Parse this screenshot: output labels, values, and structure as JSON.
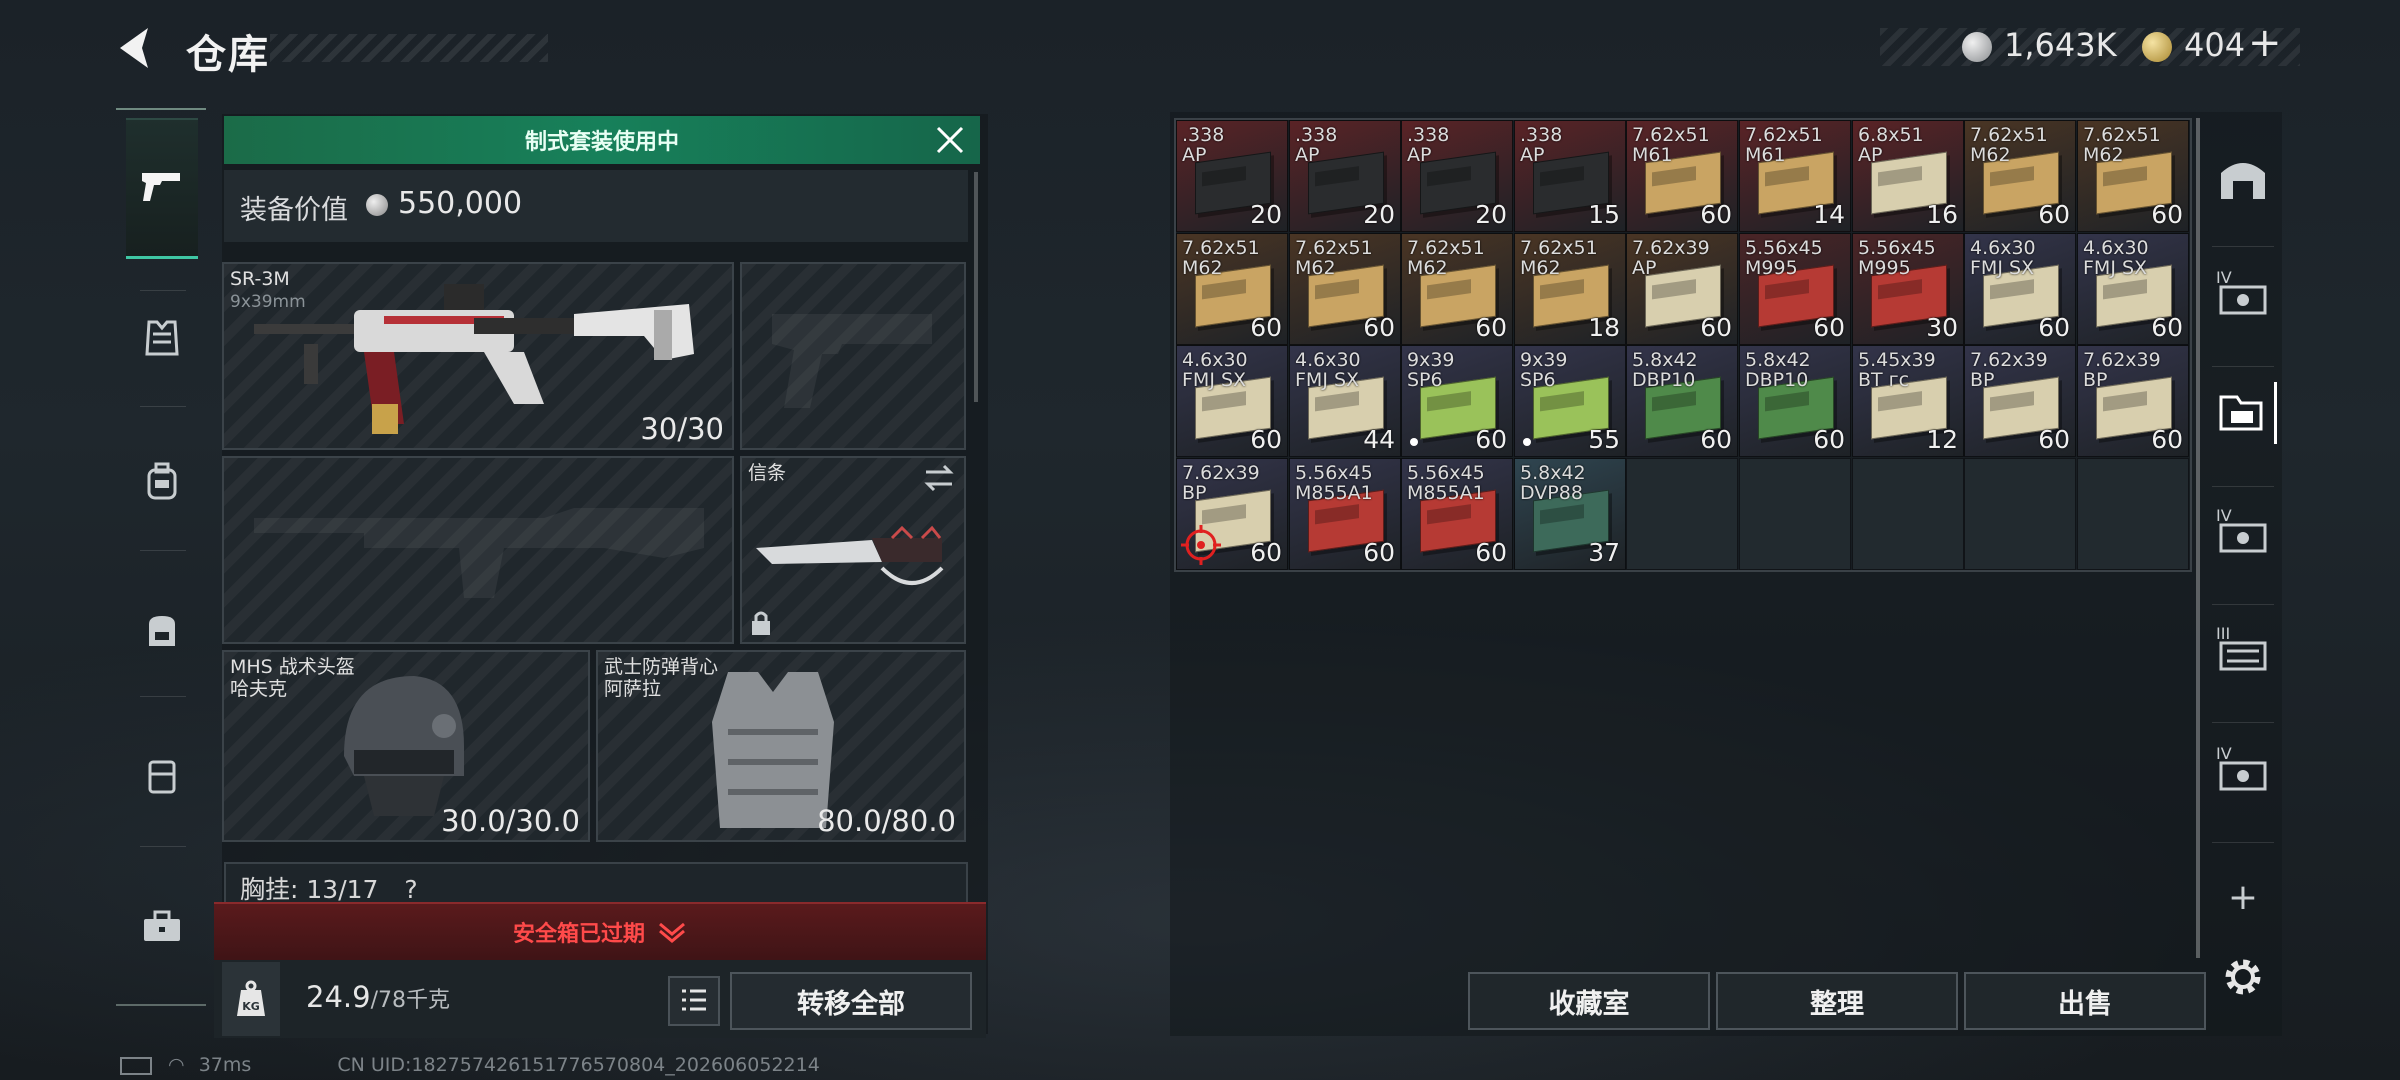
{
  "header": {
    "title": "仓库",
    "silver_amount": "1,643K",
    "gold_amount": "404",
    "add_symbol": "+"
  },
  "left_nav": {
    "icons": [
      "pistol-icon",
      "armor-vest-icon",
      "backpack-icon",
      "bag-icon",
      "case-icon",
      "toolbox-icon"
    ]
  },
  "loadout": {
    "banner": "制式套装使用中",
    "value_label": "装备价值",
    "value_amount": "550,000",
    "primary": {
      "name": "SR-3M",
      "caliber": "9x39mm",
      "ammo": "30/30"
    },
    "melee": {
      "name": "信条"
    },
    "helmet": {
      "name": "MHS 战术头盔",
      "sub": "哈夫克",
      "durability": "30.0/30.0"
    },
    "armor": {
      "name": "武士防弹背心",
      "sub": "阿萨拉",
      "durability": "80.0/80.0"
    },
    "chest_rig": {
      "label": "胸挂:",
      "capacity": "13/17",
      "help": "?"
    },
    "safe_box": "安全箱已过期",
    "weight_current": "24.9",
    "weight_max": "/78千克",
    "kg_label": "KG",
    "transfer_all": "转移全部"
  },
  "storage": {
    "cells": [
      {
        "l1": ".338",
        "l2": "AP",
        "count": "20",
        "bg": "#5a2326",
        "box": "#2a2c2e"
      },
      {
        "l1": ".338",
        "l2": "AP",
        "count": "20",
        "bg": "#5a2326",
        "box": "#2a2c2e"
      },
      {
        "l1": ".338",
        "l2": "AP",
        "count": "20",
        "bg": "#5a2326",
        "box": "#2a2c2e"
      },
      {
        "l1": ".338",
        "l2": "AP",
        "count": "15",
        "bg": "#5a2326",
        "box": "#2a2c2e"
      },
      {
        "l1": "7.62x51",
        "l2": "M61",
        "count": "60",
        "bg": "#5a2326",
        "box": "#c9a463"
      },
      {
        "l1": "7.62x51",
        "l2": "M61",
        "count": "14",
        "bg": "#5a2326",
        "box": "#c9a463"
      },
      {
        "l1": "6.8x51",
        "l2": "AP",
        "count": "16",
        "bg": "#5a2326",
        "box": "#d8cfae"
      },
      {
        "l1": "7.62x51",
        "l2": "M62",
        "count": "60",
        "bg": "#4a3524",
        "box": "#c9a463"
      },
      {
        "l1": "7.62x51",
        "l2": "M62",
        "count": "60",
        "bg": "#4a3524",
        "box": "#c9a463"
      },
      {
        "l1": "7.62x51",
        "l2": "M62",
        "count": "60",
        "bg": "#4a3524",
        "box": "#c9a463"
      },
      {
        "l1": "7.62x51",
        "l2": "M62",
        "count": "60",
        "bg": "#4a3524",
        "box": "#c9a463"
      },
      {
        "l1": "7.62x51",
        "l2": "M62",
        "count": "60",
        "bg": "#4a3524",
        "box": "#c9a463"
      },
      {
        "l1": "7.62x51",
        "l2": "M62",
        "count": "18",
        "bg": "#4a3524",
        "box": "#c9a463"
      },
      {
        "l1": "7.62x39",
        "l2": "AP",
        "count": "60",
        "bg": "#4a3524",
        "box": "#d8cfae"
      },
      {
        "l1": "5.56x45",
        "l2": "M995",
        "count": "60",
        "bg": "#4a2426",
        "box": "#b63a34"
      },
      {
        "l1": "5.56x45",
        "l2": "M995",
        "count": "30",
        "bg": "#4a2426",
        "box": "#b63a34"
      },
      {
        "l1": "4.6x30",
        "l2": "FMJ SX",
        "count": "60",
        "bg": "#33344a",
        "box": "#d8cfae"
      },
      {
        "l1": "4.6x30",
        "l2": "FMJ SX",
        "count": "60",
        "bg": "#33344a",
        "box": "#d8cfae"
      },
      {
        "l1": "4.6x30",
        "l2": "FMJ SX",
        "count": "60",
        "bg": "#33344a",
        "box": "#d8cfae"
      },
      {
        "l1": "4.6x30",
        "l2": "FMJ SX",
        "count": "44",
        "bg": "#33344a",
        "box": "#d8cfae"
      },
      {
        "l1": "9x39",
        "l2": "SP6",
        "count": "60",
        "bg": "#33344a",
        "box": "#9ac25a",
        "dot": true
      },
      {
        "l1": "9x39",
        "l2": "SP6",
        "count": "55",
        "bg": "#33344a",
        "box": "#9ac25a",
        "dot": true
      },
      {
        "l1": "5.8x42",
        "l2": "DBP10",
        "count": "60",
        "bg": "#33344a",
        "box": "#4f8a4a"
      },
      {
        "l1": "5.8x42",
        "l2": "DBP10",
        "count": "60",
        "bg": "#33344a",
        "box": "#4f8a4a"
      },
      {
        "l1": "5.45x39",
        "l2": "BT гс",
        "count": "12",
        "bg": "#33344a",
        "box": "#d8cfae"
      },
      {
        "l1": "7.62x39",
        "l2": "BP",
        "count": "60",
        "bg": "#33344a",
        "box": "#d8cfae"
      },
      {
        "l1": "7.62x39",
        "l2": "BP",
        "count": "60",
        "bg": "#33344a",
        "box": "#d8cfae"
      },
      {
        "l1": "7.62x39",
        "l2": "BP",
        "count": "60",
        "bg": "#33344a",
        "box": "#d8cfae",
        "target": true
      },
      {
        "l1": "5.56x45",
        "l2": "M855A1",
        "count": "60",
        "bg": "#33344a",
        "box": "#b63a34"
      },
      {
        "l1": "5.56x45",
        "l2": "M855A1",
        "count": "60",
        "bg": "#33344a",
        "box": "#b63a34"
      },
      {
        "l1": "5.8x42",
        "l2": "DVP88",
        "count": "37",
        "bg": "#2f4550",
        "box": "#3d6a5a"
      }
    ]
  },
  "bottom_buttons": {
    "collection": "收藏室",
    "sort": "整理",
    "sell": "出售"
  },
  "right_nav": {
    "tier_labels": [
      "IV",
      "IV",
      "III",
      "IV"
    ],
    "add": "+"
  },
  "status_bar": {
    "ping": "37ms",
    "uid": "CN UID:182757426151776570804_202606052214"
  }
}
